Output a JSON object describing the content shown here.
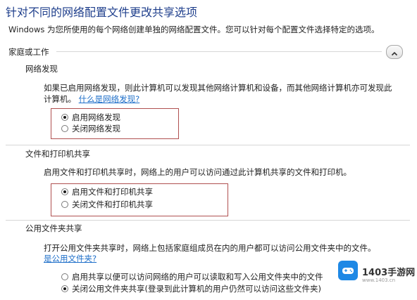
{
  "page_title": "针对不同的网络配置文件更改共享选项",
  "description": "Windows 为您所使用的每个网络创建单独的网络配置文件。您可以针对每个配置文件选择特定的选项。",
  "profile": {
    "label": "家庭或工作",
    "collapse_icon": "chevron-up-icon"
  },
  "network_discovery": {
    "title": "网络发现",
    "paragraph_line1": "如果已启用网络发现，则此计算机可以发现其他网络计算机和设备，而其他网络计算机亦可发现此",
    "paragraph_line2": "计算机。",
    "help_link": "什么是网络发现?",
    "options": [
      {
        "label": "启用网络发现",
        "selected": true
      },
      {
        "label": "关闭网络发现",
        "selected": false
      }
    ]
  },
  "file_printer_sharing": {
    "title": "文件和打印机共享",
    "paragraph": "启用文件和打印机共享时，网络上的用户可以访问通过此计算机共享的文件和打印机。",
    "options": [
      {
        "label": "启用文件和打印机共享",
        "selected": true
      },
      {
        "label": "关闭文件和打印机共享",
        "selected": false
      }
    ]
  },
  "public_folder_sharing": {
    "title": "公用文件夹共享",
    "paragraph_line1": "打开公用文件夹共享时，网络上包括家庭组成员在内的用户都可以访问公用文件夹中的文件。",
    "help_link": "是公用文件夹?",
    "options": [
      {
        "label": "启用共享以便可以访问网络的用户可以读取和写入公用文件夹中的文件",
        "selected": false
      },
      {
        "label": "关闭公用文件夹共享(登录到此计算机的用户仍然可以访问这些文件夹)",
        "selected": true
      }
    ]
  },
  "watermark": {
    "brand": "1403手游网",
    "sub": "www.1403.cn"
  },
  "colors": {
    "title": "#1f3f8c",
    "link": "#1e6fc9",
    "highlight": "#b05050"
  }
}
